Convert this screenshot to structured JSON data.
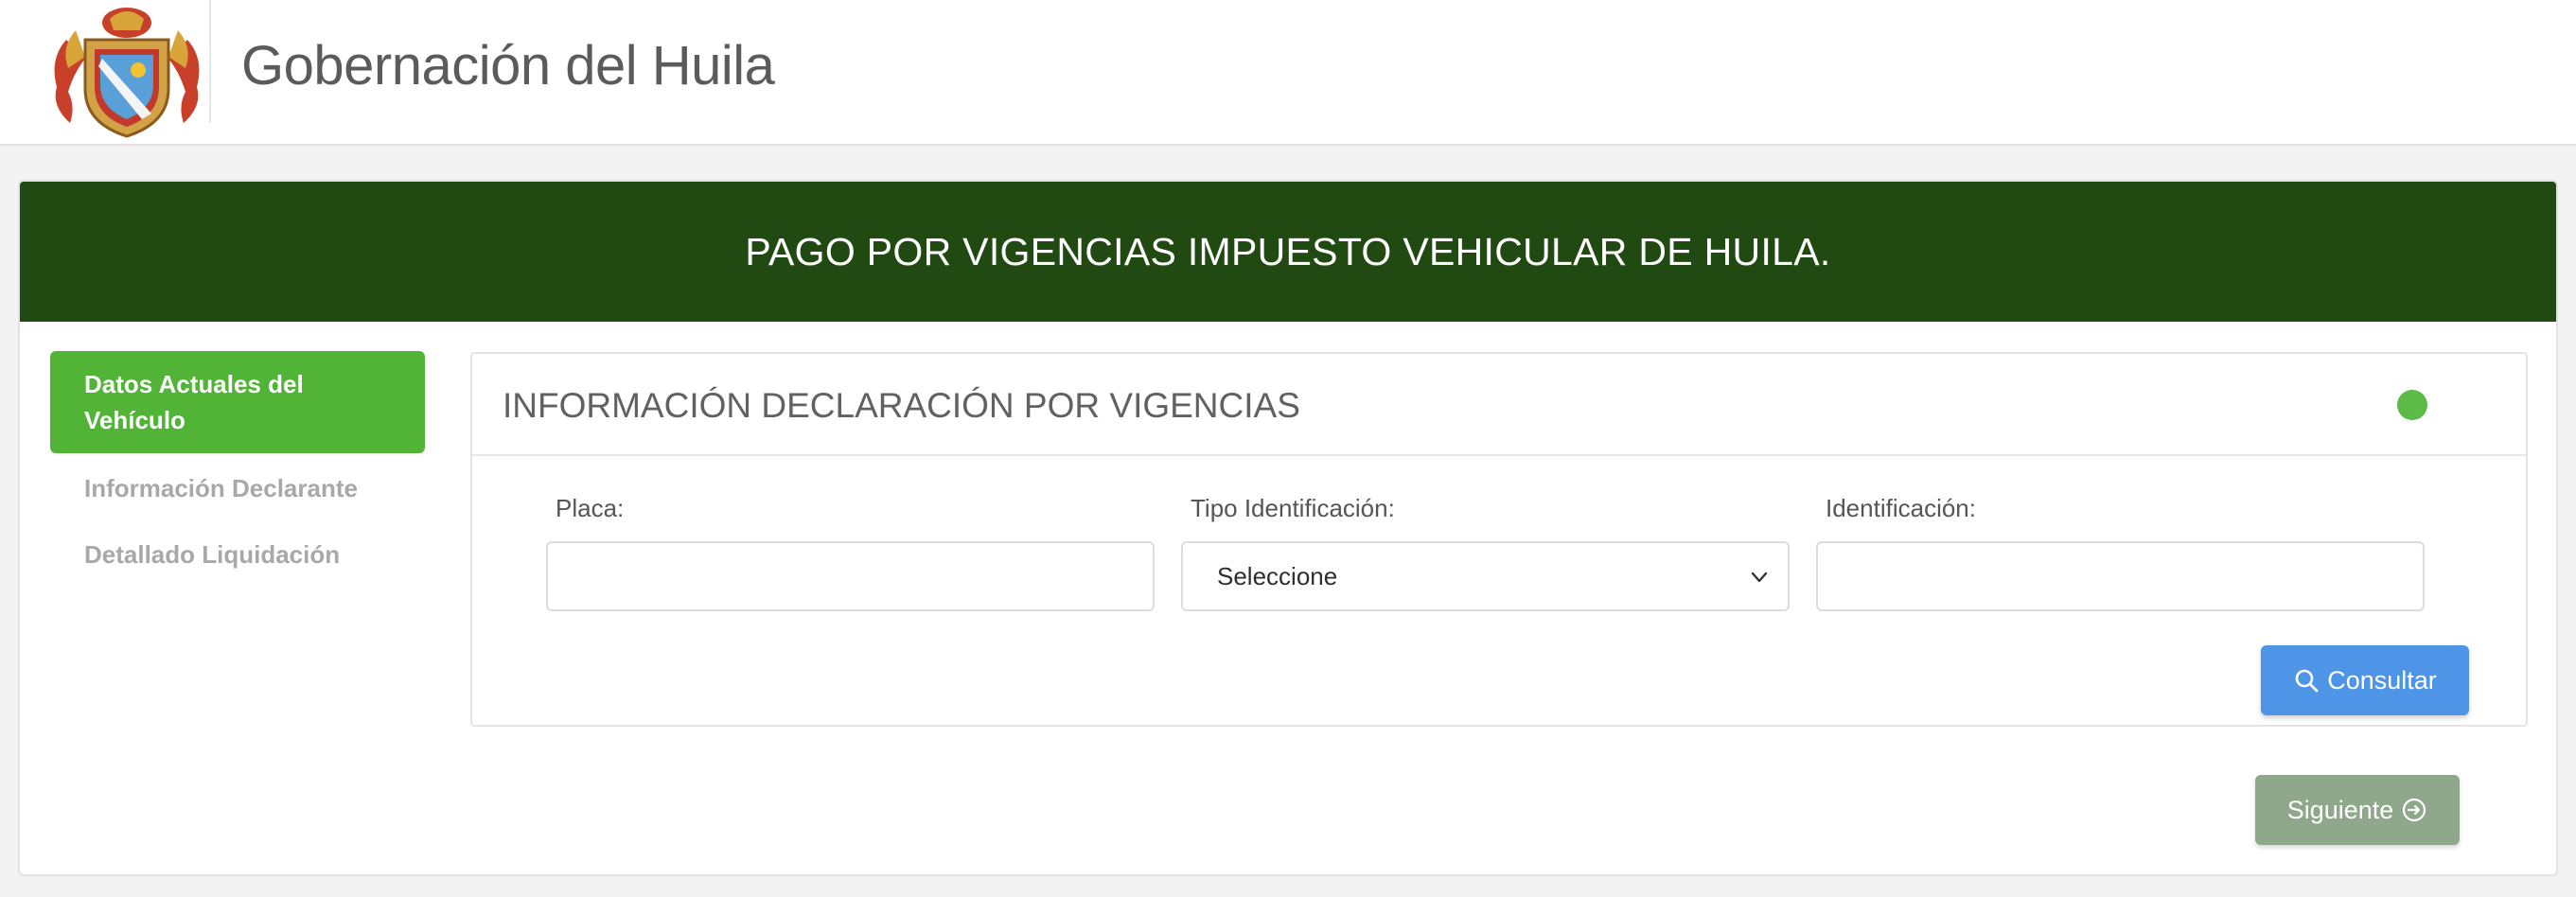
{
  "header": {
    "title": "Gobernación del Huila",
    "logo_icon": "coat-of-arms-icon"
  },
  "banner": {
    "title": "PAGO POR VIGENCIAS IMPUESTO VEHICULAR DE HUILA."
  },
  "steps": [
    {
      "label": "Datos Actuales del Vehículo",
      "active": true
    },
    {
      "label": "Información Declarante",
      "active": false
    },
    {
      "label": "Detallado Liquidación",
      "active": false
    }
  ],
  "panel": {
    "title": "INFORMACIÓN DECLARACIÓN POR VIGENCIAS",
    "status_color": "#5cba47"
  },
  "form": {
    "placa": {
      "label": "Placa:",
      "value": "",
      "placeholder": ""
    },
    "tipo_identificacion": {
      "label": "Tipo Identificación:",
      "selected": "Seleccione"
    },
    "identificacion": {
      "label": "Identificación:",
      "value": "",
      "placeholder": ""
    }
  },
  "buttons": {
    "consultar": {
      "label": "Consultar",
      "icon": "search-icon",
      "color": "#4e95e7"
    },
    "siguiente": {
      "label": "Siguiente",
      "icon": "arrow-circle-right-icon",
      "color": "#8fa88b"
    }
  },
  "colors": {
    "banner": "#214a12",
    "active_step": "#52b437"
  }
}
